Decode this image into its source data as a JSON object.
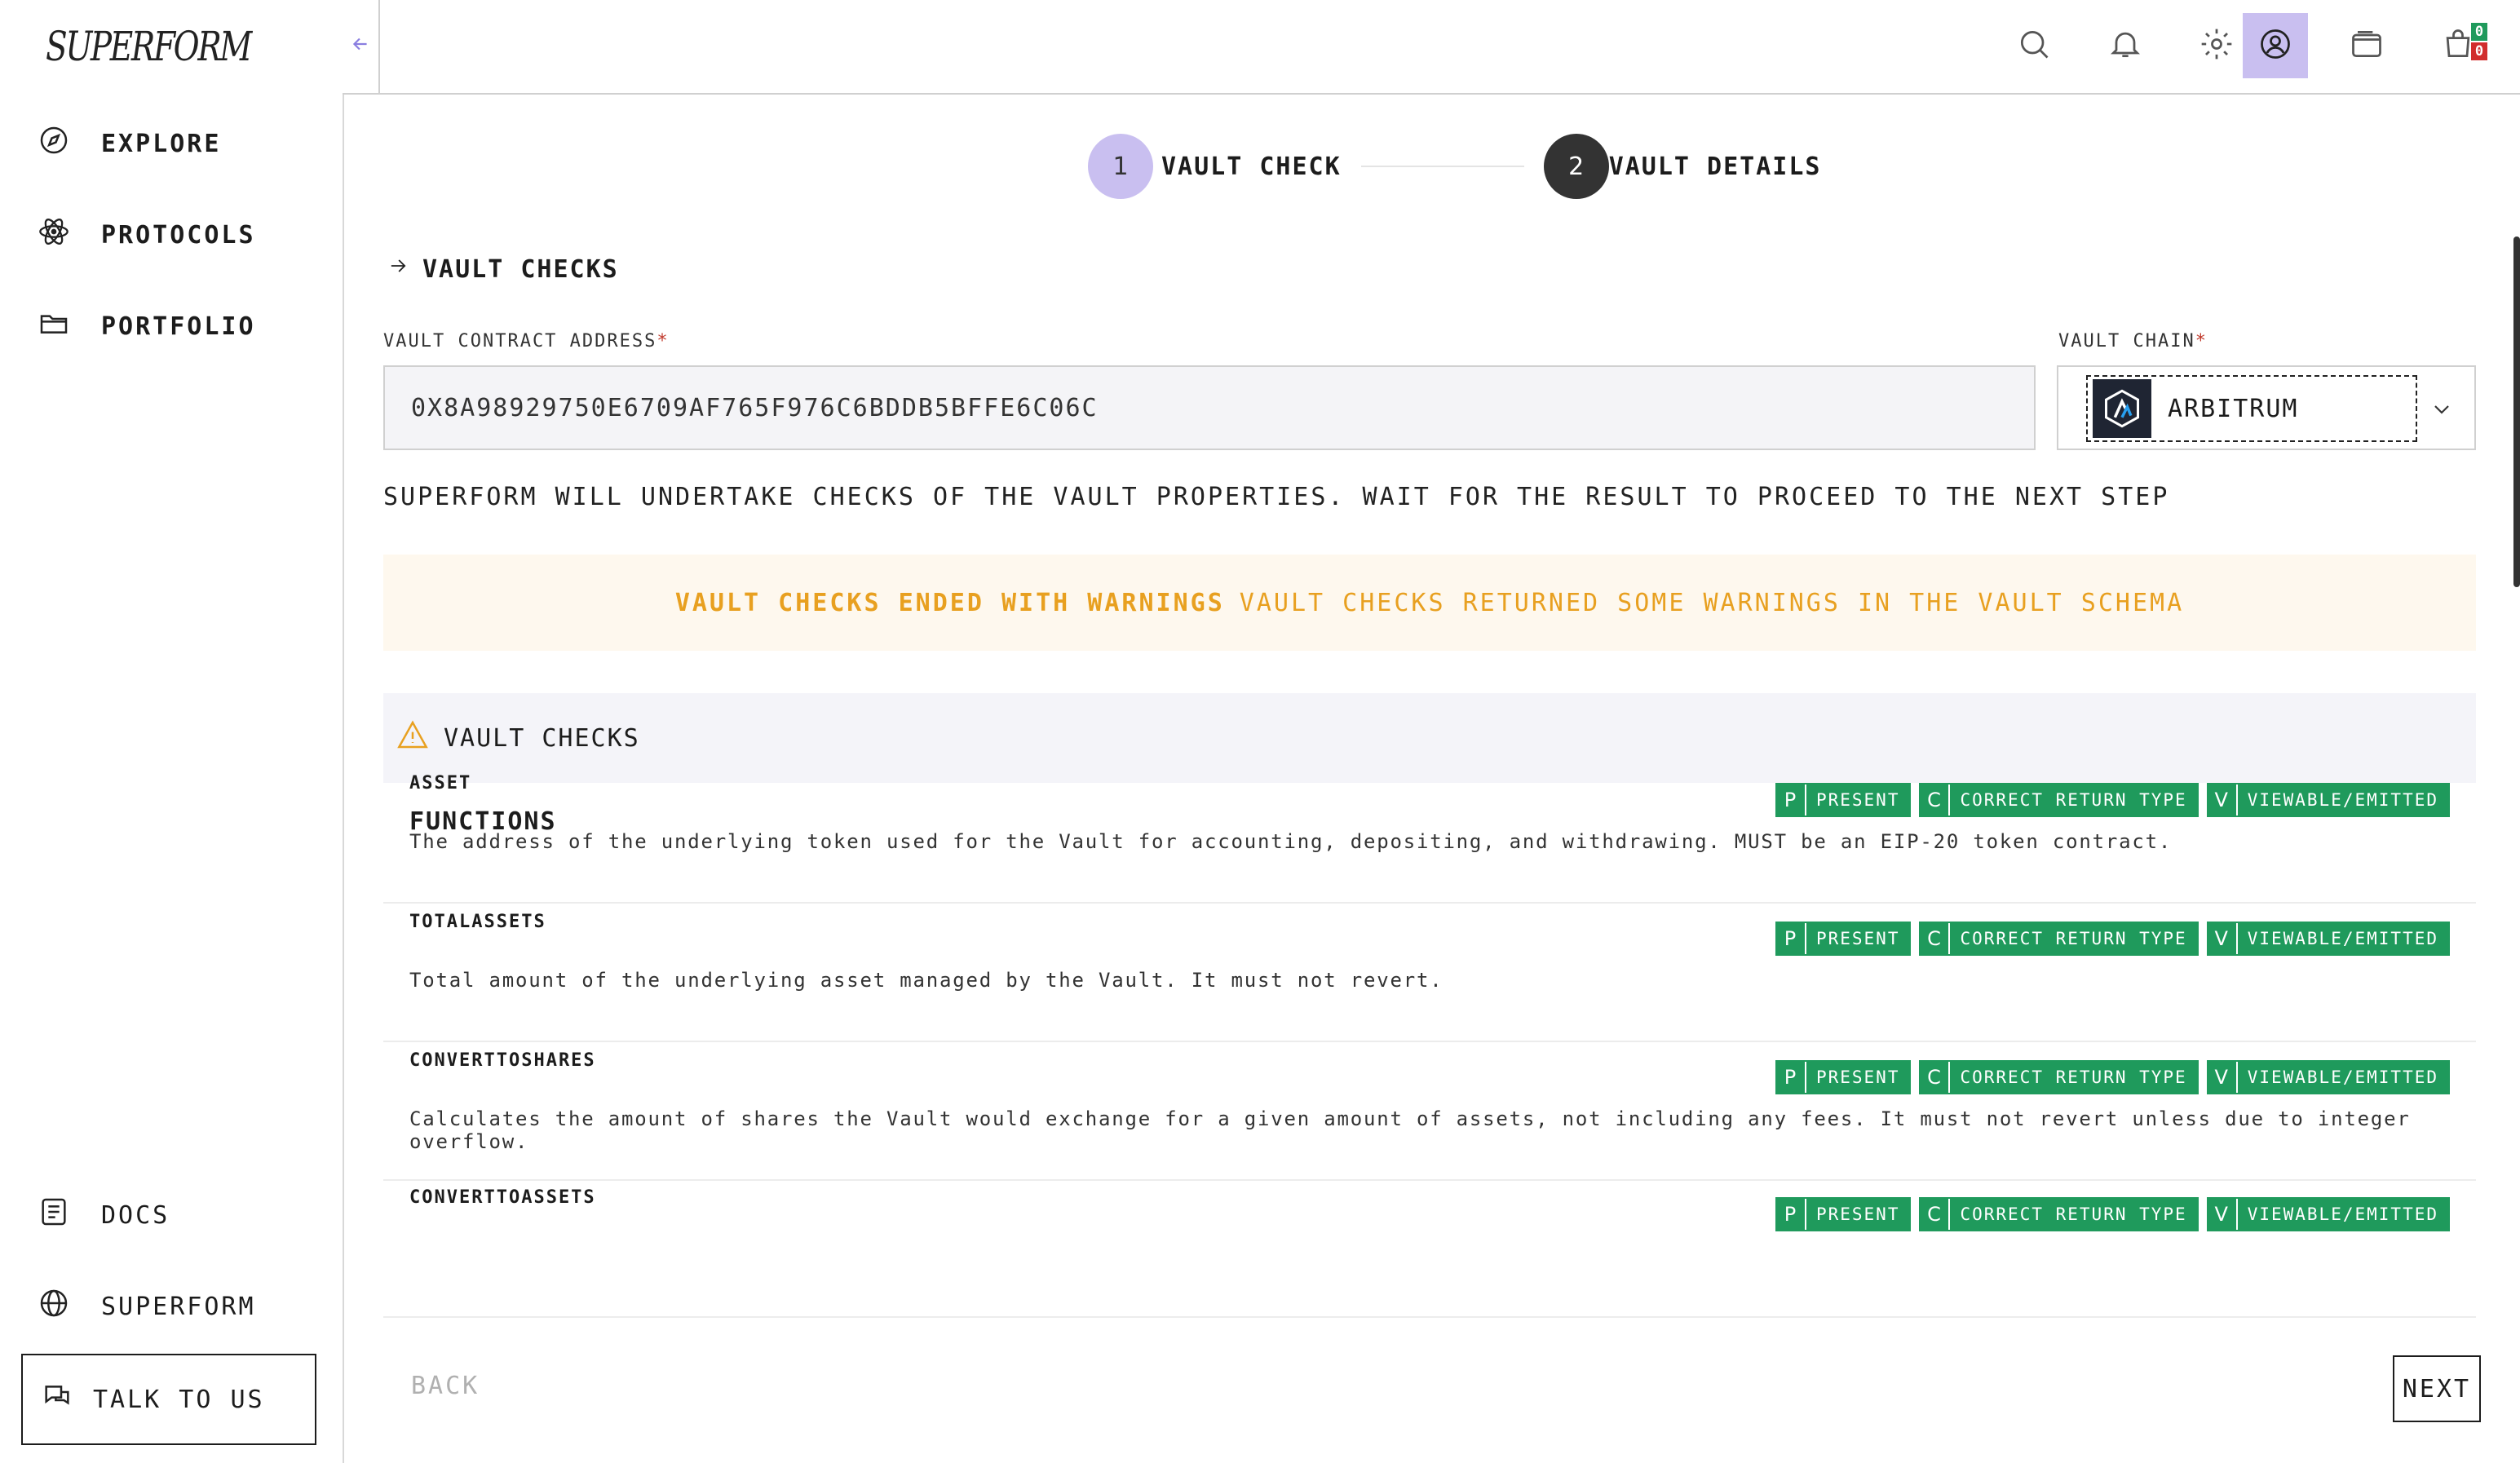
{
  "brand": {
    "logo": "SUPERFORM"
  },
  "sidebar": {
    "items": [
      {
        "label": "EXPLORE"
      },
      {
        "label": "PROTOCOLS"
      },
      {
        "label": "PORTFOLIO"
      }
    ],
    "bottom_items": [
      {
        "label": "DOCS"
      },
      {
        "label": "SUPERFORM"
      }
    ],
    "talk_label": "TALK TO US"
  },
  "topbar": {
    "cart_badge_top": "0",
    "cart_badge_bottom": "0",
    "accent": "#c9bff0"
  },
  "stepper": {
    "steps": [
      {
        "number": "1",
        "label": "VAULT CHECK",
        "state": "active"
      },
      {
        "number": "2",
        "label": "VAULT DETAILS",
        "state": "upcoming"
      }
    ]
  },
  "form": {
    "section_title": "VAULT CHECKS",
    "address_label": "VAULT CONTRACT ADDRESS",
    "address_value": "0X8A98929750E6709AF765F976C6BDDB5BFFE6C06C",
    "chain_label": "VAULT CHAIN",
    "chain_value": "ARBITRUM",
    "required_mark": "*"
  },
  "info_text": "SUPERFORM WILL UNDERTAKE CHECKS OF THE VAULT PROPERTIES. WAIT FOR THE RESULT TO PROCEED TO THE NEXT STEP",
  "warning": {
    "title": "VAULT CHECKS ENDED WITH WARNINGS",
    "message": "VAULT CHECKS RETURNED SOME WARNINGS IN THE VAULT SCHEMA",
    "color": "#e8a020"
  },
  "checks": {
    "header": "VAULT CHECKS",
    "functions_title": "FUNCTIONS",
    "tag_color": "#1f9a5c",
    "functions": [
      {
        "name": "ASSET",
        "description": "The address of the underlying token used for the Vault for accounting, depositing, and withdrawing. MUST be an EIP-20 token contract.",
        "tags": [
          {
            "key": "P",
            "label": "PRESENT"
          },
          {
            "key": "C",
            "label": "CORRECT RETURN TYPE"
          },
          {
            "key": "V",
            "label": "VIEWABLE/EMITTED"
          }
        ]
      },
      {
        "name": "TOTALASSETS",
        "description": "Total amount of the underlying asset managed by the Vault. It must not revert.",
        "tags": [
          {
            "key": "P",
            "label": "PRESENT"
          },
          {
            "key": "C",
            "label": "CORRECT RETURN TYPE"
          },
          {
            "key": "V",
            "label": "VIEWABLE/EMITTED"
          }
        ]
      },
      {
        "name": "CONVERTTOSHARES",
        "description": "Calculates the amount of shares the Vault would exchange for a given amount of assets, not including any fees. It must not revert unless due to integer overflow.",
        "tags": [
          {
            "key": "P",
            "label": "PRESENT"
          },
          {
            "key": "C",
            "label": "CORRECT RETURN TYPE"
          },
          {
            "key": "V",
            "label": "VIEWABLE/EMITTED"
          }
        ]
      },
      {
        "name": "CONVERTTOASSETS",
        "description": "",
        "tags": [
          {
            "key": "P",
            "label": "PRESENT"
          },
          {
            "key": "C",
            "label": "CORRECT RETURN TYPE"
          },
          {
            "key": "V",
            "label": "VIEWABLE/EMITTED"
          }
        ]
      }
    ]
  },
  "footer": {
    "back_label": "BACK",
    "next_label": "NEXT"
  }
}
